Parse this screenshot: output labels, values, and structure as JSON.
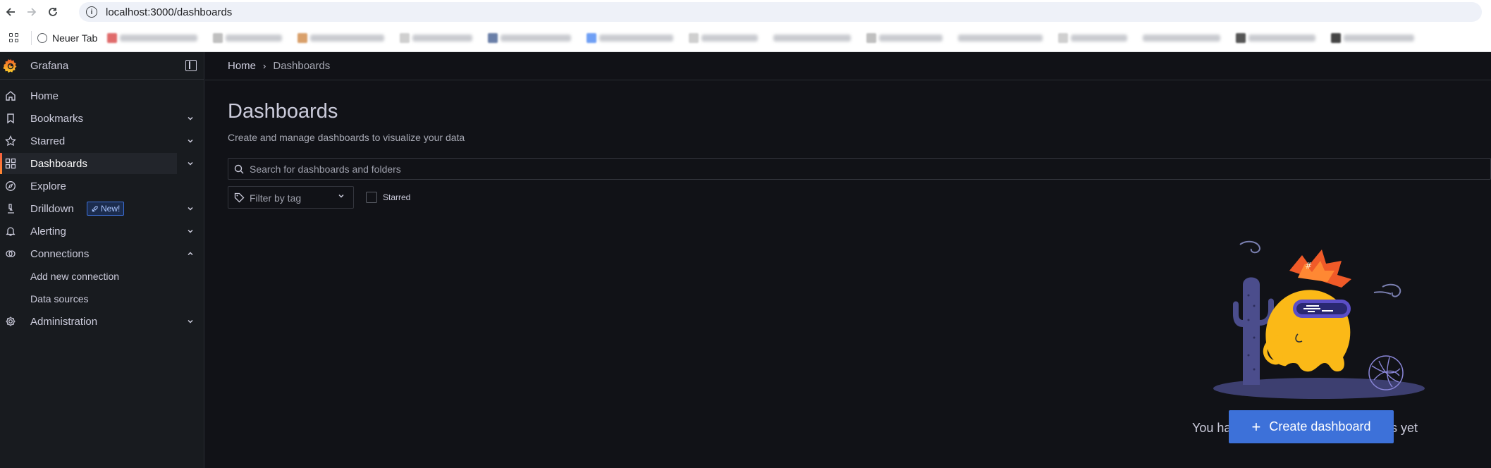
{
  "browser": {
    "url": "localhost:3000/dashboards",
    "bookmark_newtab": "Neuer Tab"
  },
  "app": {
    "brand": "Grafana",
    "breadcrumb": {
      "home": "Home",
      "current": "Dashboards"
    },
    "nav": [
      {
        "label": "Home",
        "icon": "home-icon"
      },
      {
        "label": "Bookmarks",
        "icon": "bookmark-icon",
        "expandable": true
      },
      {
        "label": "Starred",
        "icon": "star-icon",
        "expandable": true
      },
      {
        "label": "Dashboards",
        "icon": "apps-icon",
        "expandable": true,
        "active": true
      },
      {
        "label": "Explore",
        "icon": "compass-icon"
      },
      {
        "label": "Drilldown",
        "icon": "microscope-icon",
        "expandable": true,
        "badge": "New!"
      },
      {
        "label": "Alerting",
        "icon": "bell-icon",
        "expandable": true
      },
      {
        "label": "Connections",
        "icon": "link-icon",
        "expandable": true,
        "expanded": true
      },
      {
        "label": "Add new connection",
        "sub": true
      },
      {
        "label": "Data sources",
        "sub": true
      },
      {
        "label": "Administration",
        "icon": "cog-icon",
        "expandable": true
      }
    ],
    "page": {
      "title": "Dashboards",
      "subtitle": "Create and manage dashboards to visualize your data",
      "search_placeholder": "Search for dashboards and folders",
      "tag_filter_placeholder": "Filter by tag",
      "starred_label": "Starred",
      "empty_message": "You haven't created any dashboards yet",
      "create_button": "Create dashboard"
    }
  },
  "colors": {
    "accent": "#3d71d9",
    "active_indicator": "#f55f3e",
    "background": "#111217",
    "sidebar": "#181b1f"
  }
}
